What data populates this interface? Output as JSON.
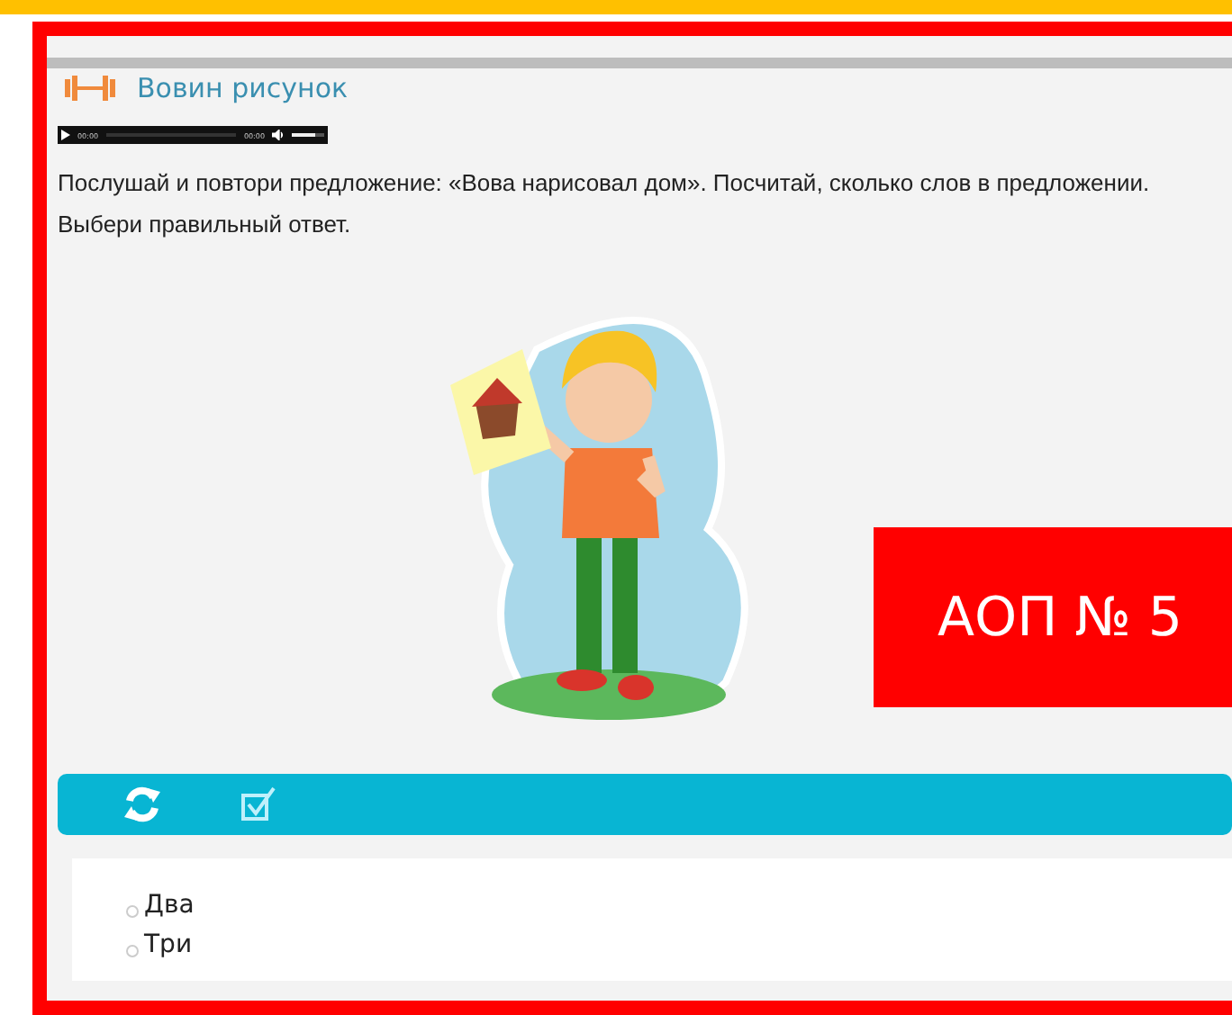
{
  "title": "Вовин рисунок",
  "audio": {
    "current": "00:00",
    "duration": "00:00",
    "volume": {
      "level": 0.7
    }
  },
  "question": "Послушай и повтори предложение: «Вова нарисовал дом». Посчитай, сколько слов в предложении. Выбери правильный ответ.",
  "badge": "АОП № 5",
  "options": [
    {
      "label": "Два",
      "selected": false
    },
    {
      "label": "Три",
      "selected": false
    }
  ]
}
